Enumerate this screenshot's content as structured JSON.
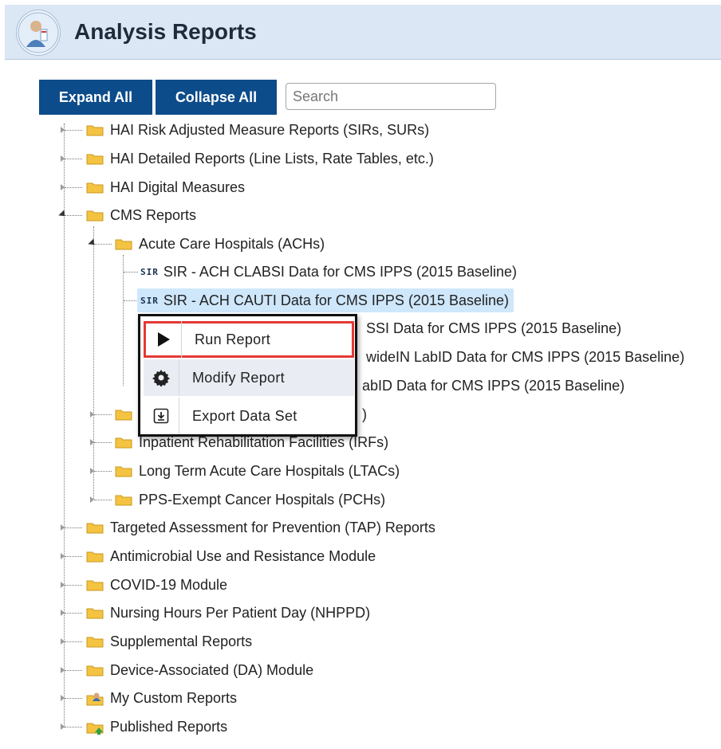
{
  "header": {
    "title": "Analysis Reports",
    "logo_icon": "nurse-logo-icon"
  },
  "toolbar": {
    "expand_all": "Expand All",
    "collapse_all": "Collapse All",
    "search_placeholder": "Search"
  },
  "tree": {
    "root": [
      "HAI Risk Adjusted Measure Reports (SIRs, SURs)",
      "HAI Detailed Reports (Line Lists, Rate Tables, etc.)",
      "HAI Digital Measures",
      "CMS Reports"
    ],
    "cms_children": {
      "ach": "Acute Care Hospitals (ACHs)",
      "ach_reports": [
        "SIR - ACH CLABSI Data for CMS IPPS (2015 Baseline)",
        "SIR - ACH CAUTI Data for CMS IPPS (2015 Baseline)",
        "SSI Data for CMS IPPS (2015 Baseline)",
        "wideIN LabID Data for CMS IPPS (2015 Baseline)",
        "abID Data for CMS IPPS (2015 Baseline)"
      ],
      "partial_after_menu": ")",
      "irf": "Inpatient Rehabilitation Facilities (IRFs)",
      "ltac": "Long Term Acute Care Hospitals (LTACs)",
      "pch": "PPS-Exempt Cancer Hospitals (PCHs)"
    },
    "root_after": [
      "Targeted Assessment for Prevention (TAP) Reports",
      "Antimicrobial Use and Resistance Module",
      "COVID-19 Module",
      "Nursing Hours Per Patient Day (NHPPD)",
      "Supplemental Reports",
      "Device-Associated (DA) Module",
      "My Custom Reports",
      "Published Reports"
    ],
    "sir_badge": "SIR"
  },
  "context_menu": {
    "run": "Run Report",
    "modify": "Modify Report",
    "export": "Export Data Set"
  },
  "colors": {
    "button": "#0d4c8b",
    "header": "#dbe7f5",
    "selected": "#cfe7fb",
    "highlight_border": "#e53935",
    "folder": "#f5c342"
  }
}
